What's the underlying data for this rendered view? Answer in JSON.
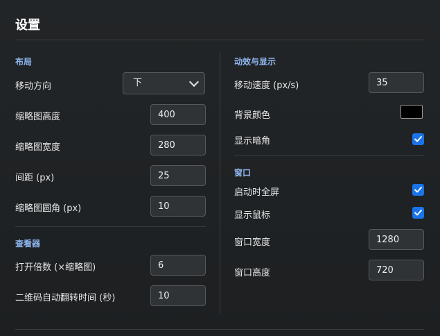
{
  "title": "设置",
  "layout": {
    "section_title": "布局",
    "direction_label": "移动方向",
    "direction_value": "下",
    "thumb_height_label": "缩略图高度",
    "thumb_height_value": "400",
    "thumb_width_label": "缩略图宽度",
    "thumb_width_value": "280",
    "spacing_label": "间距 (px)",
    "spacing_value": "25",
    "radius_label": "缩略图圆角 (px)",
    "radius_value": "10"
  },
  "viewer": {
    "section_title": "查看器",
    "open_scale_label": "打开倍数 (×缩略图)",
    "open_scale_value": "6",
    "qr_flip_label": "二维码自动翻转时间 (秒)",
    "qr_flip_value": "10"
  },
  "effects": {
    "section_title": "动效与显示",
    "speed_label": "移动速度 (px/s)",
    "speed_value": "35",
    "bg_color_label": "背景颜色",
    "bg_color": "#000000",
    "vignette_label": "显示暗角",
    "vignette_checked": true
  },
  "window": {
    "section_title": "窗口",
    "fullscreen_label": "启动时全屏",
    "fullscreen_checked": true,
    "cursor_label": "显示鼠标",
    "cursor_checked": true,
    "width_label": "窗口宽度",
    "width_value": "1280",
    "height_label": "窗口高度",
    "height_value": "720"
  },
  "colors": {
    "accent": "#1a73e8",
    "section_title": "#8fb7f0"
  }
}
